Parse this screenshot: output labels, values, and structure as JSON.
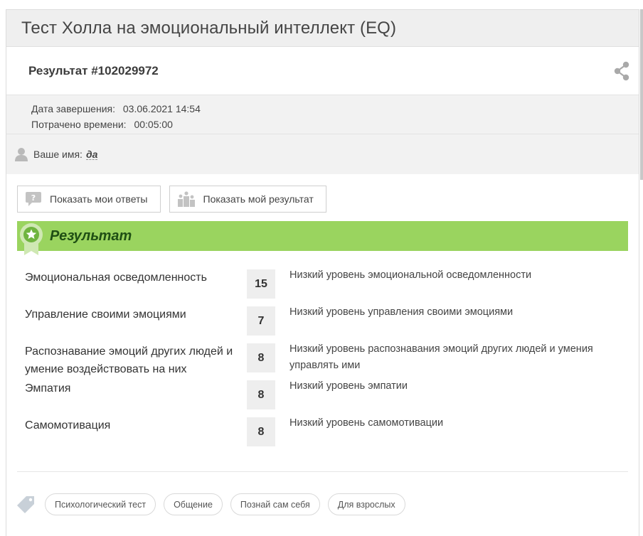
{
  "page": {
    "title": "Тест Холла на эмоциональный интеллект (EQ)"
  },
  "result": {
    "id_label": "Результат #102029972",
    "completed_label": "Дата завершения:",
    "completed_value": "03.06.2021 14:54",
    "spent_label": "Потрачено времени:",
    "spent_value": "00:05:00",
    "name_label": "Ваше имя:",
    "name_value": "да"
  },
  "buttons": {
    "show_answers": "Показать мои ответы",
    "show_result": "Показать мой результат"
  },
  "section": {
    "title": "Результат"
  },
  "scores": [
    {
      "name": "Эмоциональная осведомленность",
      "score": "15",
      "desc": "Низкий уровень эмоциональной осведомленности"
    },
    {
      "name": "Управление своими эмоциями",
      "score": "7",
      "desc": "Низкий уровень управления своими эмоциями"
    },
    {
      "name": "Распознавание эмоций других людей и умение воздействовать на них",
      "score": "8",
      "desc": "Низкий уровень распознавания эмоций других людей и умения управлять ими"
    },
    {
      "name": "Эмпатия",
      "score": "8",
      "desc": "Низкий уровень эмпатии"
    },
    {
      "name": "Самомотивация",
      "score": "8",
      "desc": "Низкий уровень самомотивации"
    }
  ],
  "tags": [
    "Психологический тест",
    "Общение",
    "Познай сам себя",
    "Для взрослых"
  ],
  "colors": {
    "accent": "#9ad45f",
    "accent_text": "#1f4f14"
  },
  "icons": [
    "share-icon",
    "user-icon",
    "question-chat-icon",
    "podium-icon",
    "award-badge-icon",
    "tag-icon"
  ]
}
